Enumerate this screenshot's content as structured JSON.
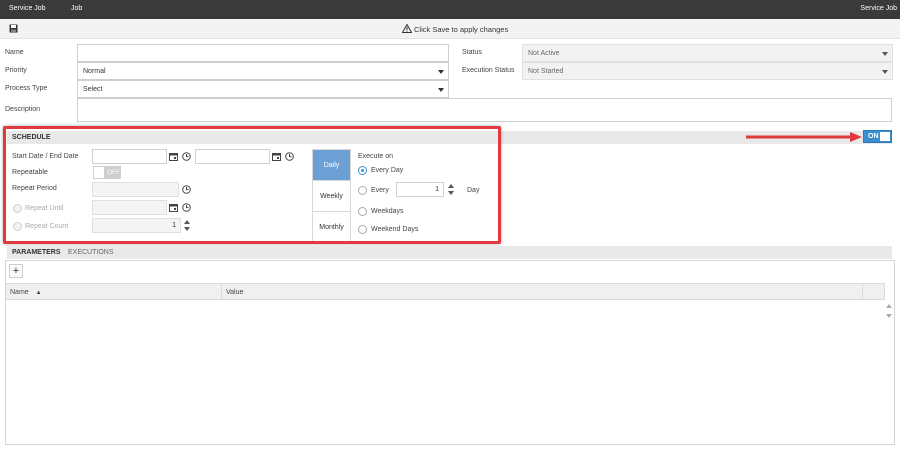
{
  "topbar": {
    "left_title": "Service Job",
    "center_title": "Job",
    "right_title": "Service Job"
  },
  "toolbar": {
    "save_icon": "save-icon",
    "notice": "Click Save to apply changes",
    "notice_icon": "warning-icon"
  },
  "form": {
    "name_label": "Name",
    "name_value": "",
    "priority_label": "Priority",
    "priority_value": "Normal",
    "process_type_label": "Process Type",
    "process_type_value": "Select",
    "description_label": "Description",
    "description_value": "",
    "status_label": "Status",
    "status_value": "Not Active",
    "execution_status_label": "Execution Status",
    "execution_status_value": "Not Started"
  },
  "schedule": {
    "title": "SCHEDULE",
    "enabled_label": "ON",
    "start_end_label": "Start Date / End Date",
    "repeatable_label": "Repeatable",
    "repeatable_toggle_label": "OFF",
    "repeat_period_label": "Repeat Period",
    "repeat_until_label": "Repeat Until",
    "repeat_count_label": "Repeat Count",
    "repeat_count_value": "1",
    "tabs": [
      "Daily",
      "Weekly",
      "Monthly"
    ],
    "active_tab": "Daily",
    "execute_on_label": "Execute on",
    "options": {
      "every_day": "Every Day",
      "every": "Every",
      "every_value": "1",
      "every_unit": "Day",
      "weekdays": "Weekdays",
      "weekend_days": "Weekend Days"
    },
    "selected_option": "Every Day"
  },
  "bottom": {
    "tabs": [
      "PARAMETERS",
      "EXECUTIONS"
    ],
    "active_tab": "PARAMETERS",
    "add_label": "+",
    "columns": [
      "Name",
      "Value"
    ],
    "sort_indicator": "▲"
  },
  "colors": {
    "accent": "#3a8fd1",
    "highlight": "#e0393e",
    "topbar": "#3a3a3a",
    "active_tab": "#6c9fd3"
  }
}
